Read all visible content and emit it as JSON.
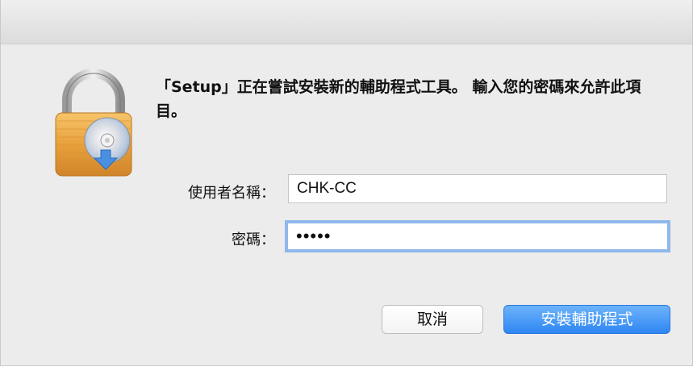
{
  "dialog": {
    "message": "「Setup」正在嘗試安裝新的輔助程式工具。 輸入您的密碼來允許此項目。",
    "icon": "lock-with-disc-icon"
  },
  "form": {
    "username_label": "使用者名稱：",
    "username_value": "CHK-CC",
    "password_label": "密碼：",
    "password_value": "•••••"
  },
  "buttons": {
    "cancel_label": "取消",
    "install_label": "安裝輔助程式"
  },
  "colors": {
    "accent": "#3b8ff5",
    "focus_ring": "#8fb8ec",
    "lock_body": "#e8a13c"
  }
}
